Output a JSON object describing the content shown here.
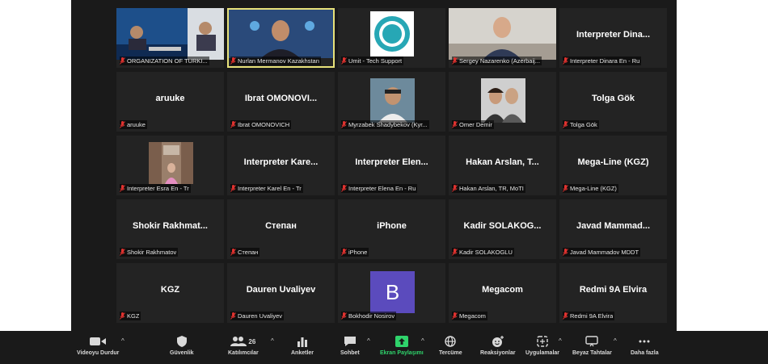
{
  "participants": [
    {
      "label": "ORGANIZATION OF TURKI...",
      "big": "",
      "video": "conf"
    },
    {
      "label": "Nurlan Mermanov Kazakhstan",
      "big": "",
      "video": "man"
    },
    {
      "label": "Umit - Tech Support",
      "big": "",
      "video": "logo"
    },
    {
      "label": "Sergey Nazarenko (Azerbaij...",
      "big": "",
      "video": "man2"
    },
    {
      "label": "Interpreter Dinara En - Ru",
      "big": "Interpreter Dina...",
      "video": ""
    },
    {
      "label": "aruuke",
      "big": "aruuke",
      "video": ""
    },
    {
      "label": "Ibrat OMONOVICH",
      "big": "Ibrat OMONOVI...",
      "video": ""
    },
    {
      "label": "Myrzabek Shadybekov (Kyr...",
      "big": "",
      "video": "photo"
    },
    {
      "label": "Omer Demir",
      "big": "",
      "video": "couple"
    },
    {
      "label": "Tolga Gök",
      "big": "Tolga Gök",
      "video": ""
    },
    {
      "label": "Interpreter Esra En - Tr",
      "big": "",
      "video": "street"
    },
    {
      "label": "Interpreter Karel En - Tr",
      "big": "Interpreter Kare...",
      "video": ""
    },
    {
      "label": "Interpreter Elena En - Ru",
      "big": "Interpreter Elen...",
      "video": ""
    },
    {
      "label": "Hakan Arslan, TR, MoTI",
      "big": "Hakan Arslan, T...",
      "video": ""
    },
    {
      "label": "Mega-Line (KGZ)",
      "big": "Mega-Line (KGZ)",
      "video": ""
    },
    {
      "label": "Shokir Rakhmatov",
      "big": "Shokir Rakhmat...",
      "video": ""
    },
    {
      "label": "Степан",
      "big": "Степан",
      "video": ""
    },
    {
      "label": "iPhone",
      "big": "iPhone",
      "video": ""
    },
    {
      "label": "Kadir SOLAKOGLU",
      "big": "Kadir SOLAKOG...",
      "video": ""
    },
    {
      "label": "Javad Mammadov MDDT",
      "big": "Javad Mammad...",
      "video": ""
    },
    {
      "label": "KGZ",
      "big": "KGZ",
      "video": ""
    },
    {
      "label": "Dauren Uvaliyev",
      "big": "Dauren Uvaliyev",
      "video": ""
    },
    {
      "label": "Bokhodir Nosirov",
      "big": "",
      "video": "avatar",
      "initial": "B"
    },
    {
      "label": "Megacom",
      "big": "Megacom",
      "video": ""
    },
    {
      "label": "Redmi 9A Elvira",
      "big": "Redmi 9A Elvira",
      "video": ""
    }
  ],
  "toolbar": {
    "video": "Videoyu Durdur",
    "security": "Güvenlik",
    "participants": "Katılımcılar",
    "participants_count": "26",
    "polls": "Anketler",
    "chat": "Sohbet",
    "share": "Ekran Paylaşımı",
    "translate": "Tercüme",
    "reactions": "Reaksiyonlar",
    "apps": "Uygulamalar",
    "whiteboard": "Beyaz Tahtalar",
    "more": "Daha fazla"
  },
  "colors": {
    "background": "#1a1a1a",
    "tile": "#232323",
    "active_border": "#e8e27a",
    "share_green": "#2fd36b",
    "muted_red": "#e0322f",
    "avatar": "#5b4bbd"
  }
}
